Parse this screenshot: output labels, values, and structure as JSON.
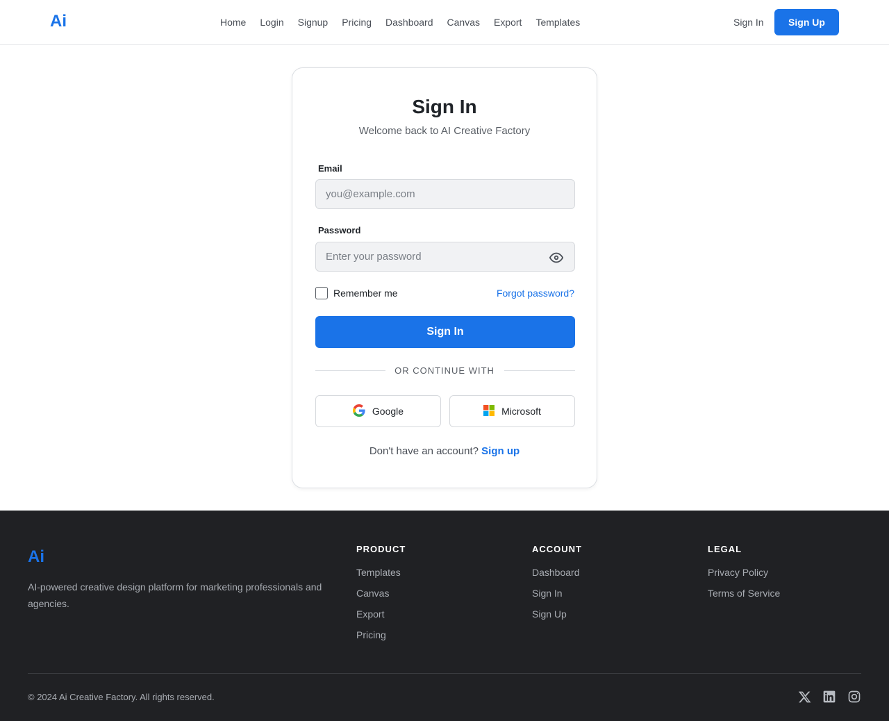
{
  "header": {
    "logo": "Ai",
    "nav": [
      "Home",
      "Login",
      "Signup",
      "Pricing",
      "Dashboard",
      "Canvas",
      "Export",
      "Templates"
    ],
    "sign_in": "Sign In",
    "sign_up": "Sign Up"
  },
  "card": {
    "title": "Sign In",
    "subtitle": "Welcome back to AI Creative Factory",
    "email_label": "Email",
    "email_placeholder": "you@example.com",
    "email_value": "",
    "password_label": "Password",
    "password_placeholder": "Enter your password",
    "password_value": "",
    "remember_label": "Remember me",
    "remember_checked": false,
    "forgot": "Forgot password?",
    "submit": "Sign In",
    "divider": "OR CONTINUE WITH",
    "google": "Google",
    "microsoft": "Microsoft",
    "no_account": "Don't have an account?",
    "sign_up_link": "Sign up"
  },
  "footer": {
    "logo": "Ai",
    "description": "AI-powered creative design platform for marketing professionals and agencies.",
    "columns": [
      {
        "title": "PRODUCT",
        "links": [
          "Templates",
          "Canvas",
          "Export",
          "Pricing"
        ]
      },
      {
        "title": "ACCOUNT",
        "links": [
          "Dashboard",
          "Sign In",
          "Sign Up"
        ]
      },
      {
        "title": "LEGAL",
        "links": [
          "Privacy Policy",
          "Terms of Service"
        ]
      }
    ],
    "copyright": "© 2024 Ai Creative Factory. All rights reserved.",
    "social_icons": [
      "x-icon",
      "linkedin-icon",
      "instagram-icon"
    ]
  },
  "colors": {
    "brand": "#1a73e8",
    "footer_bg": "#202124"
  }
}
